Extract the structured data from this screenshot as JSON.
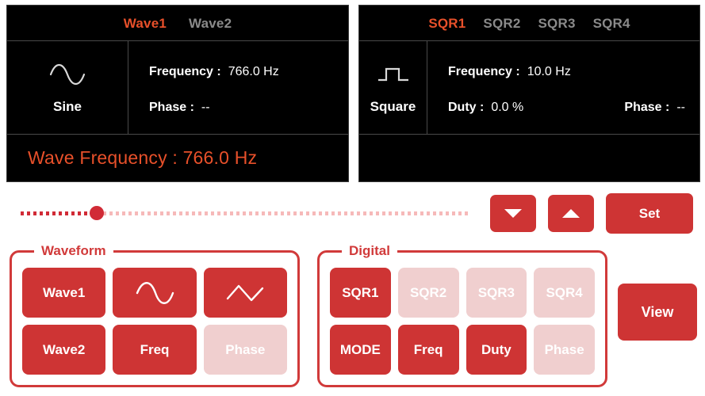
{
  "wave_display": {
    "tabs": [
      {
        "label": "Wave1",
        "active": true
      },
      {
        "label": "Wave2",
        "active": false
      }
    ],
    "type_icon": "sine-wave-icon",
    "type_name": "Sine",
    "frequency_label": "Frequency :",
    "frequency_value": "766.0 Hz",
    "phase_label": "Phase :",
    "phase_value": "--",
    "summary": "Wave Frequency :  766.0 Hz"
  },
  "digital_display": {
    "tabs": [
      {
        "label": "SQR1",
        "active": true
      },
      {
        "label": "SQR2",
        "active": false
      },
      {
        "label": "SQR3",
        "active": false
      },
      {
        "label": "SQR4",
        "active": false
      }
    ],
    "type_icon": "square-wave-icon",
    "type_name": "Square",
    "frequency_label": "Frequency :",
    "frequency_value": "10.0 Hz",
    "duty_label": "Duty :",
    "duty_value": "0.0 %",
    "phase_label": "Phase :",
    "phase_value": "--",
    "summary": ""
  },
  "slider": {
    "name": "frequency-slider",
    "position_percent": 17
  },
  "controls": {
    "down_label": "",
    "up_label": "",
    "set_label": "Set",
    "view_label": "View"
  },
  "waveform_group": {
    "title": "Waveform",
    "buttons": [
      {
        "label": "Wave1",
        "icon": "",
        "muted": false
      },
      {
        "label": "",
        "icon": "sine-wave-icon",
        "muted": false
      },
      {
        "label": "",
        "icon": "triangle-wave-icon",
        "muted": false
      },
      {
        "label": "Wave2",
        "icon": "",
        "muted": false
      },
      {
        "label": "Freq",
        "icon": "",
        "muted": false
      },
      {
        "label": "Phase",
        "icon": "",
        "muted": true
      }
    ]
  },
  "digital_group": {
    "title": "Digital",
    "buttons": [
      {
        "label": "SQR1",
        "muted": false
      },
      {
        "label": "SQR2",
        "muted": true
      },
      {
        "label": "SQR3",
        "muted": true
      },
      {
        "label": "SQR4",
        "muted": true
      },
      {
        "label": "MODE",
        "muted": false
      },
      {
        "label": "Freq",
        "muted": false
      },
      {
        "label": "Duty",
        "muted": false
      },
      {
        "label": "Phase",
        "muted": true
      }
    ]
  },
  "colors": {
    "accent_orange": "#E8502A",
    "button_red": "#CE3434",
    "muted_pink": "#F0CFCF",
    "group_border": "#D13A3A",
    "display_bg": "#000000"
  }
}
